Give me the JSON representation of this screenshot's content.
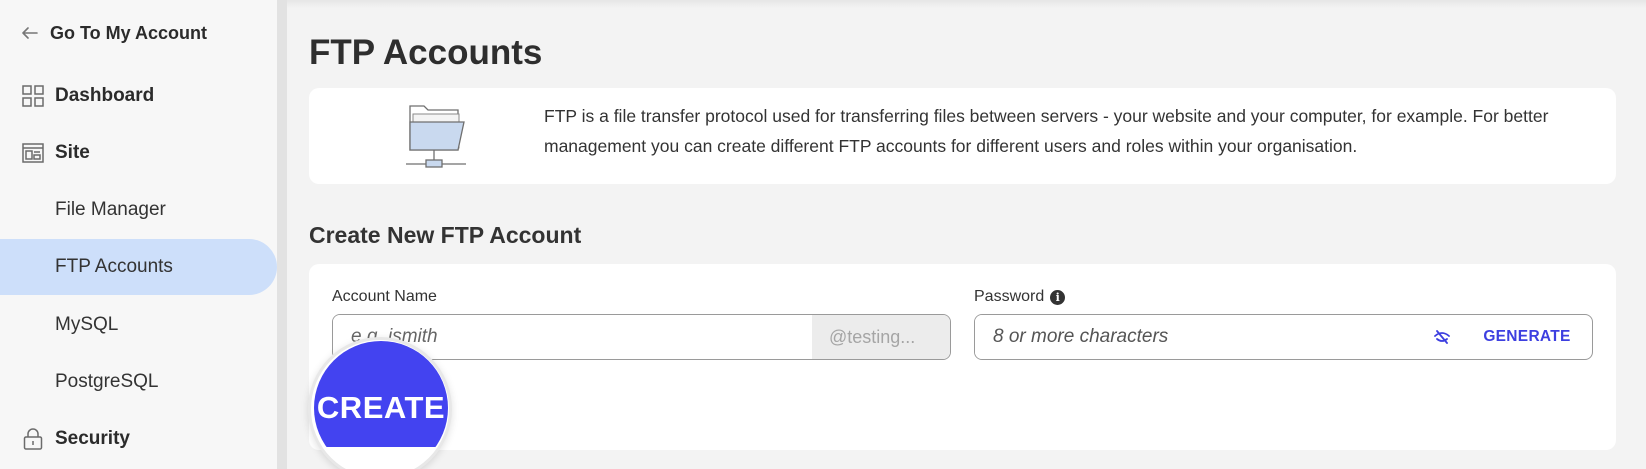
{
  "sidebar": {
    "back_label": "Go To My Account",
    "items": [
      {
        "label": "Dashboard",
        "icon": "grid-icon"
      },
      {
        "label": "Site",
        "icon": "site-icon"
      },
      {
        "label": "File Manager"
      },
      {
        "label": "FTP Accounts"
      },
      {
        "label": "MySQL"
      },
      {
        "label": "PostgreSQL"
      },
      {
        "label": "Security",
        "icon": "lock-icon"
      }
    ]
  },
  "page": {
    "title": "FTP Accounts",
    "info_text": "FTP is a file transfer protocol used for transferring files between servers - your website and your computer, for example. For better management you can create different FTP accounts for different users and roles within your organisation."
  },
  "form": {
    "section_title": "Create New FTP Account",
    "account_label": "Account Name",
    "account_placeholder": "e.g. jsmith",
    "account_suffix": "@testing...",
    "password_label": "Password",
    "password_placeholder": "8 or more characters",
    "generate_label": "GENERATE",
    "create_label": "CREATE"
  },
  "colors": {
    "accent": "#4343f0",
    "active_nav_bg": "#cddffa"
  }
}
